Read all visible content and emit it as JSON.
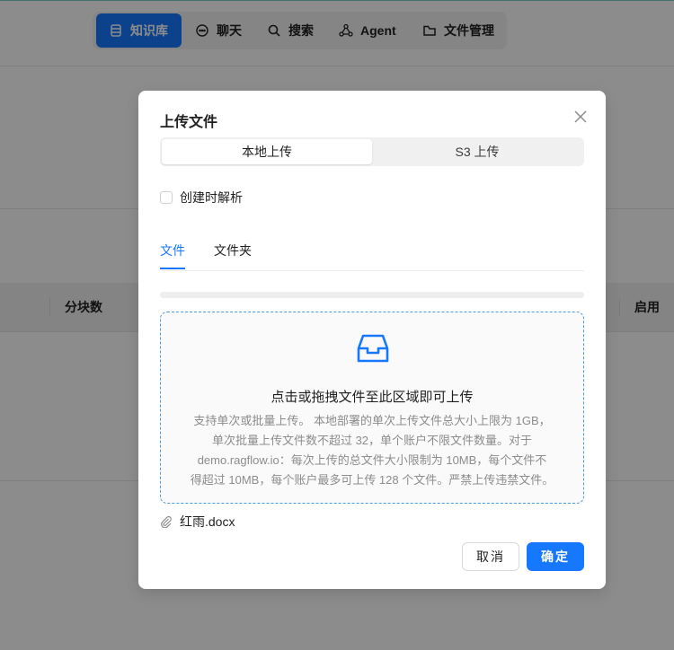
{
  "nav": {
    "items": [
      {
        "label": "知识库",
        "icon": "database-icon",
        "active": true
      },
      {
        "label": "聊天",
        "icon": "chat-bubble-icon",
        "active": false
      },
      {
        "label": "搜索",
        "icon": "search-icon",
        "active": false
      },
      {
        "label": "Agent",
        "icon": "agent-graph-icon",
        "active": false
      },
      {
        "label": "文件管理",
        "icon": "folder-icon",
        "active": false
      }
    ]
  },
  "table": {
    "headers": [
      "分块数",
      "启用"
    ]
  },
  "modal": {
    "title": "上传文件",
    "segments": [
      "本地上传",
      "S3 上传"
    ],
    "parse_on_create_label": "创建时解析",
    "tabs": [
      "文件",
      "文件夹"
    ],
    "dropzone": {
      "title": "点击或拖拽文件至此区域即可上传",
      "hint_lines": [
        "支持单次或批量上传。 本地部署的单次上传文件总大小上限为 1GB，",
        "单次批量上传文件数不超过 32，单个账户不限文件数量。对于",
        "demo.ragflow.io：每次上传的总文件大小限制为 10MB，每个文件不",
        "得超过 10MB，每个账户最多可上传 128 个文件。严禁上传违禁文件。"
      ]
    },
    "file_name": "红雨.docx",
    "cancel_label": "取消",
    "ok_label": "确定"
  },
  "colors": {
    "accent": "#1677ff",
    "mask": "rgba(0,0,0,0.45)",
    "dropzone_border": "#4a9ae0"
  }
}
